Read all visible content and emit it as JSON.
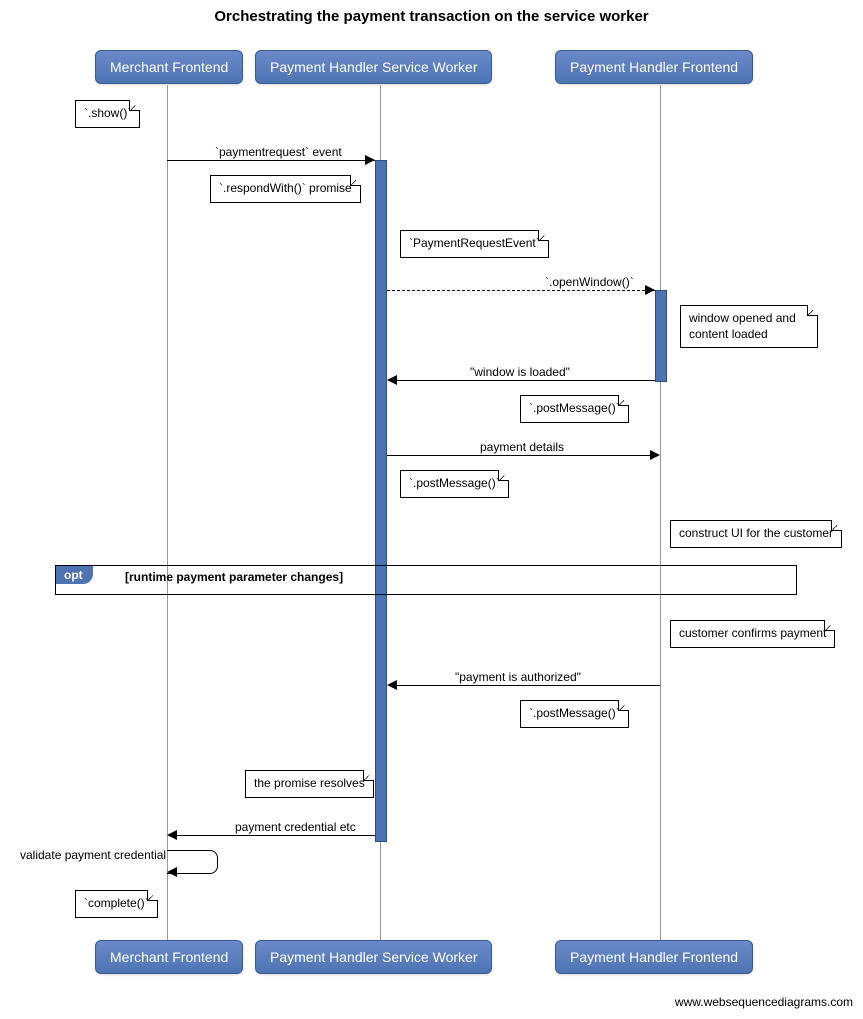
{
  "title": "Orchestrating the payment transaction on the service worker",
  "participants": {
    "p1": "Merchant Frontend",
    "p2": "Payment Handler Service Worker",
    "p3": "Payment Handler Frontend"
  },
  "notes": {
    "show": "`.show()`",
    "respondWith": "`.respondWith()` promise",
    "pre": "`PaymentRequestEvent`",
    "windowOpened": "window opened\nand content loaded",
    "postMsg1": "`.postMessage()`",
    "postMsg2": "`.postMessage()`",
    "constructUI": "construct UI for the customer",
    "customerConfirms": "customer confirms payment",
    "postMsg3": "`.postMessage()`",
    "promiseResolves": "the promise resolves",
    "complete": "`complete()`"
  },
  "messages": {
    "m1": "`paymentrequest` event",
    "m2": "`.openWindow()`",
    "m3": "\"window is loaded\"",
    "m4": "payment details",
    "m5": "\"payment is authorized\"",
    "m6": "payment credential etc",
    "m7": "validate payment credential"
  },
  "opt": {
    "tag": "opt",
    "guard": "[runtime payment parameter changes]"
  },
  "footer": "www.websequencediagrams.com"
}
